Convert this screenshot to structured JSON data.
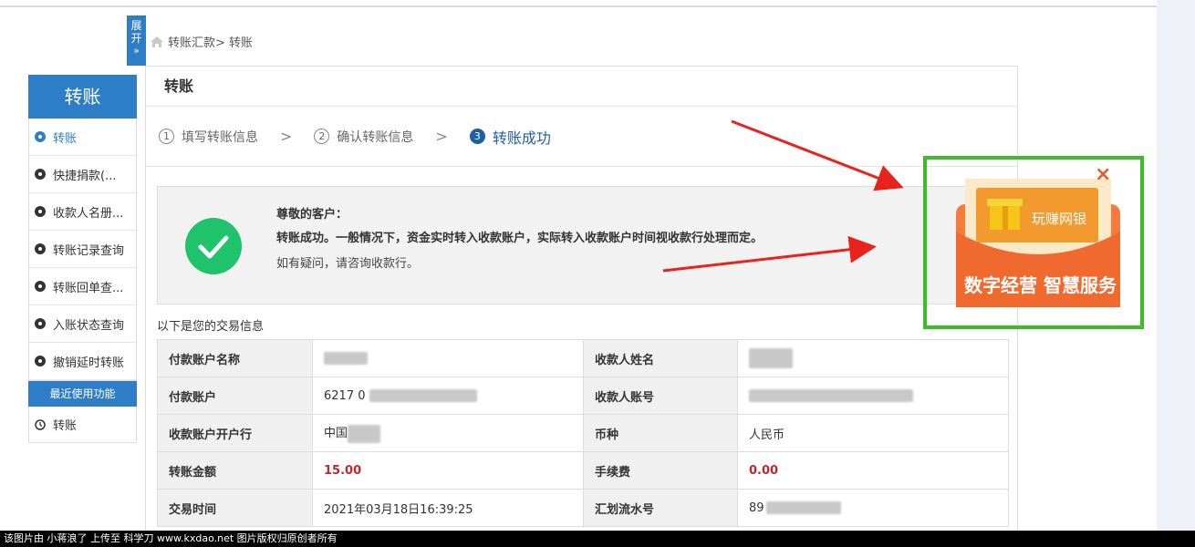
{
  "breadcrumb": {
    "text": "转账汇款> 转账"
  },
  "expand_tab": {
    "label1": "展",
    "label2": "开",
    "arrows": "»"
  },
  "sidebar": {
    "title": "转账",
    "items": [
      {
        "label": "转账",
        "active": true
      },
      {
        "label": "快捷捐款(...",
        "active": false
      },
      {
        "label": "收款人名册...",
        "active": false
      },
      {
        "label": "转账记录查询",
        "active": false
      },
      {
        "label": "转账回单查...",
        "active": false
      },
      {
        "label": "入账状态查询",
        "active": false
      },
      {
        "label": "撤销延时转账",
        "active": false
      }
    ],
    "recent_title": "最近使用功能",
    "recent_item": "转账"
  },
  "main": {
    "title": "转账",
    "steps": [
      {
        "num": "1",
        "label": "填写转账信息"
      },
      {
        "num": "2",
        "label": "确认转账信息"
      },
      {
        "num": "3",
        "label": "转账成功"
      }
    ],
    "success": {
      "greeting": "尊敬的客户：",
      "message": "转账成功。一般情况下，资金实时转入收款账户，实际转入收款账户时间视收款行处理而定。",
      "note": "如有疑问，请咨询收款行。"
    },
    "info_title": "以下是您的交易信息",
    "rows": [
      {
        "k1": "付款账户名称",
        "v1": "",
        "k2": "收款人姓名",
        "v2": ""
      },
      {
        "k1": "付款账户",
        "v1": "6217 0",
        "k2": "收款人账号",
        "v2": ""
      },
      {
        "k1": "收款账户开户行",
        "v1": "中国",
        "k2": "币种",
        "v2": "人民币"
      },
      {
        "k1": "转账金额",
        "v1": "15.00",
        "k2": "手续费",
        "v2": "0.00"
      },
      {
        "k1": "交易时间",
        "v1": "2021年03月18日16:39:25",
        "k2": "汇划流水号",
        "v2": "89"
      }
    ]
  },
  "ad": {
    "small_text": "玩赚网银",
    "big_text": "数字经营 智慧服务",
    "close_icon": "×"
  },
  "footer": {
    "text": "该图片由 小蒋浪了 上传至 科学刀 www.kxdao.net 图片版权归原创者所有"
  },
  "colors": {
    "primary": "#2e7ec7",
    "success": "#1fc36b",
    "amount": "#c1272d",
    "ad_frame": "#3bbd2a",
    "arrow": "#e8231d"
  }
}
